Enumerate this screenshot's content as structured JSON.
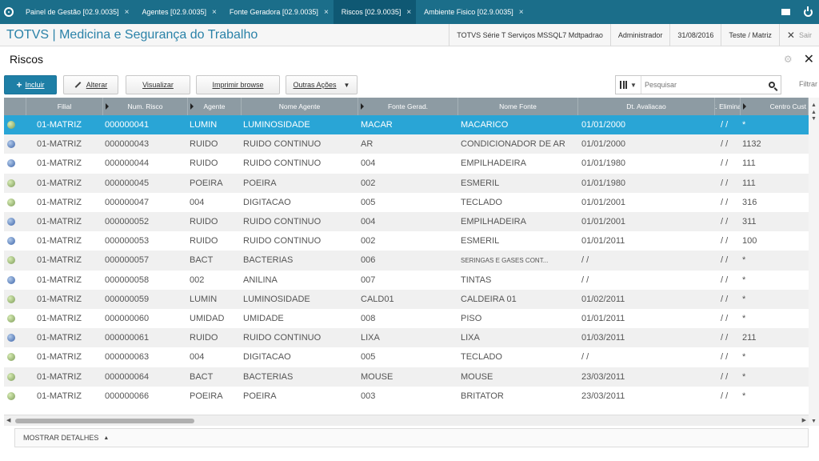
{
  "tabs": [
    {
      "label": "Painel de Gestão [02.9.0035]",
      "active": false
    },
    {
      "label": "Agentes [02.9.0035]",
      "active": false
    },
    {
      "label": "Fonte Geradora [02.9.0035]",
      "active": false
    },
    {
      "label": "Riscos [02.9.0035]",
      "active": true
    },
    {
      "label": "Ambiente Fisico [02.9.0035]",
      "active": false
    }
  ],
  "tab_close": "×",
  "app": {
    "title": "TOTVS | Medicina e Segurança do Trabalho",
    "server": "TOTVS Série T Serviços MSSQL7 Mdtpadrao",
    "user": "Administrador",
    "date": "31/08/2016",
    "company": "Teste / Matriz",
    "exit": "Sair"
  },
  "page": {
    "title": "Riscos"
  },
  "toolbar": {
    "incluir": "Incluir",
    "alterar": "Alterar",
    "visualizar": "Visualizar",
    "imprimir": "Imprimir browse",
    "outras": "Outras Ações",
    "search_placeholder": "Pesquisar",
    "filtrar": "Filtrar"
  },
  "columns": [
    "Filial",
    "Num. Risco",
    "Agente",
    "Nome Agente",
    "Fonte Gerad.",
    "Nome Fonte",
    "Dt. Avaliacao",
    "t. Elimina",
    "Centro Cust"
  ],
  "rows": [
    {
      "status": "green",
      "filial": "01-MATRIZ",
      "num": "000000041",
      "agente": "LUMIN",
      "nome_agente": "LUMINOSIDADE",
      "fonte": "MACAR",
      "nome_fonte": "MACARICO",
      "dt": "01/01/2000",
      "elim": "/ /",
      "cc": "*",
      "selected": true
    },
    {
      "status": "blue",
      "filial": "01-MATRIZ",
      "num": "000000043",
      "agente": "RUIDO",
      "nome_agente": "RUIDO CONTINUO",
      "fonte": "AR",
      "nome_fonte": "CONDICIONADOR DE AR",
      "dt": "01/01/2000",
      "elim": "/ /",
      "cc": "1132"
    },
    {
      "status": "blue",
      "filial": "01-MATRIZ",
      "num": "000000044",
      "agente": "RUIDO",
      "nome_agente": "RUIDO CONTINUO",
      "fonte": "004",
      "nome_fonte": "EMPILHADEIRA",
      "dt": "01/01/1980",
      "elim": "/ /",
      "cc": "111"
    },
    {
      "status": "green",
      "filial": "01-MATRIZ",
      "num": "000000045",
      "agente": "POEIRA",
      "nome_agente": "POEIRA",
      "fonte": "002",
      "nome_fonte": "ESMERIL",
      "dt": "01/01/1980",
      "elim": "/ /",
      "cc": "111"
    },
    {
      "status": "green",
      "filial": "01-MATRIZ",
      "num": "000000047",
      "agente": "004",
      "nome_agente": "DIGITACAO",
      "fonte": "005",
      "nome_fonte": "TECLADO",
      "dt": "01/01/2001",
      "elim": "/ /",
      "cc": "316"
    },
    {
      "status": "blue",
      "filial": "01-MATRIZ",
      "num": "000000052",
      "agente": "RUIDO",
      "nome_agente": "RUIDO CONTINUO",
      "fonte": "004",
      "nome_fonte": "EMPILHADEIRA",
      "dt": "01/01/2001",
      "elim": "/ /",
      "cc": "311"
    },
    {
      "status": "blue",
      "filial": "01-MATRIZ",
      "num": "000000053",
      "agente": "RUIDO",
      "nome_agente": "RUIDO CONTINUO",
      "fonte": "002",
      "nome_fonte": "ESMERIL",
      "dt": "01/01/2011",
      "elim": "/ /",
      "cc": "100"
    },
    {
      "status": "green",
      "filial": "01-MATRIZ",
      "num": "000000057",
      "agente": "BACT",
      "nome_agente": "BACTERIAS",
      "fonte": "006",
      "nome_fonte": "SERINGAS E GASES CONT...",
      "nome_fonte_small": true,
      "dt": "/ /",
      "elim": "/ /",
      "cc": "*"
    },
    {
      "status": "blue",
      "filial": "01-MATRIZ",
      "num": "000000058",
      "agente": "002",
      "nome_agente": "ANILINA",
      "fonte": "007",
      "nome_fonte": "TINTAS",
      "dt": "/ /",
      "elim": "/ /",
      "cc": "*"
    },
    {
      "status": "green",
      "filial": "01-MATRIZ",
      "num": "000000059",
      "agente": "LUMIN",
      "nome_agente": "LUMINOSIDADE",
      "fonte": "CALD01",
      "nome_fonte": "CALDEIRA 01",
      "dt": "01/02/2011",
      "elim": "/ /",
      "cc": "*"
    },
    {
      "status": "green",
      "filial": "01-MATRIZ",
      "num": "000000060",
      "agente": "UMIDAD",
      "nome_agente": "UMIDADE",
      "fonte": "008",
      "nome_fonte": "PISO",
      "dt": "01/01/2011",
      "elim": "/ /",
      "cc": "*"
    },
    {
      "status": "blue",
      "filial": "01-MATRIZ",
      "num": "000000061",
      "agente": "RUIDO",
      "nome_agente": "RUIDO CONTINUO",
      "fonte": "LIXA",
      "nome_fonte": "LIXA",
      "dt": "01/03/2011",
      "elim": "/ /",
      "cc": "211"
    },
    {
      "status": "green",
      "filial": "01-MATRIZ",
      "num": "000000063",
      "agente": "004",
      "nome_agente": "DIGITACAO",
      "fonte": "005",
      "nome_fonte": "TECLADO",
      "dt": "/ /",
      "elim": "/ /",
      "cc": "*"
    },
    {
      "status": "green",
      "filial": "01-MATRIZ",
      "num": "000000064",
      "agente": "BACT",
      "nome_agente": "BACTERIAS",
      "fonte": "MOUSE",
      "nome_fonte": "MOUSE",
      "dt": "23/03/2011",
      "elim": "/ /",
      "cc": "*"
    },
    {
      "status": "green",
      "filial": "01-MATRIZ",
      "num": "000000066",
      "agente": "POEIRA",
      "nome_agente": "POEIRA",
      "fonte": "003",
      "nome_fonte": "BRITATOR",
      "dt": "23/03/2011",
      "elim": "/ /",
      "cc": "*"
    }
  ],
  "details": {
    "label": "MOSTRAR DETALHES"
  },
  "colors": {
    "tabbar": "#1b6e8a",
    "accent": "#2a82a8",
    "selected_row": "#29a5d6",
    "primary_button": "#1e7fa6",
    "header": "#8d9ba3"
  }
}
